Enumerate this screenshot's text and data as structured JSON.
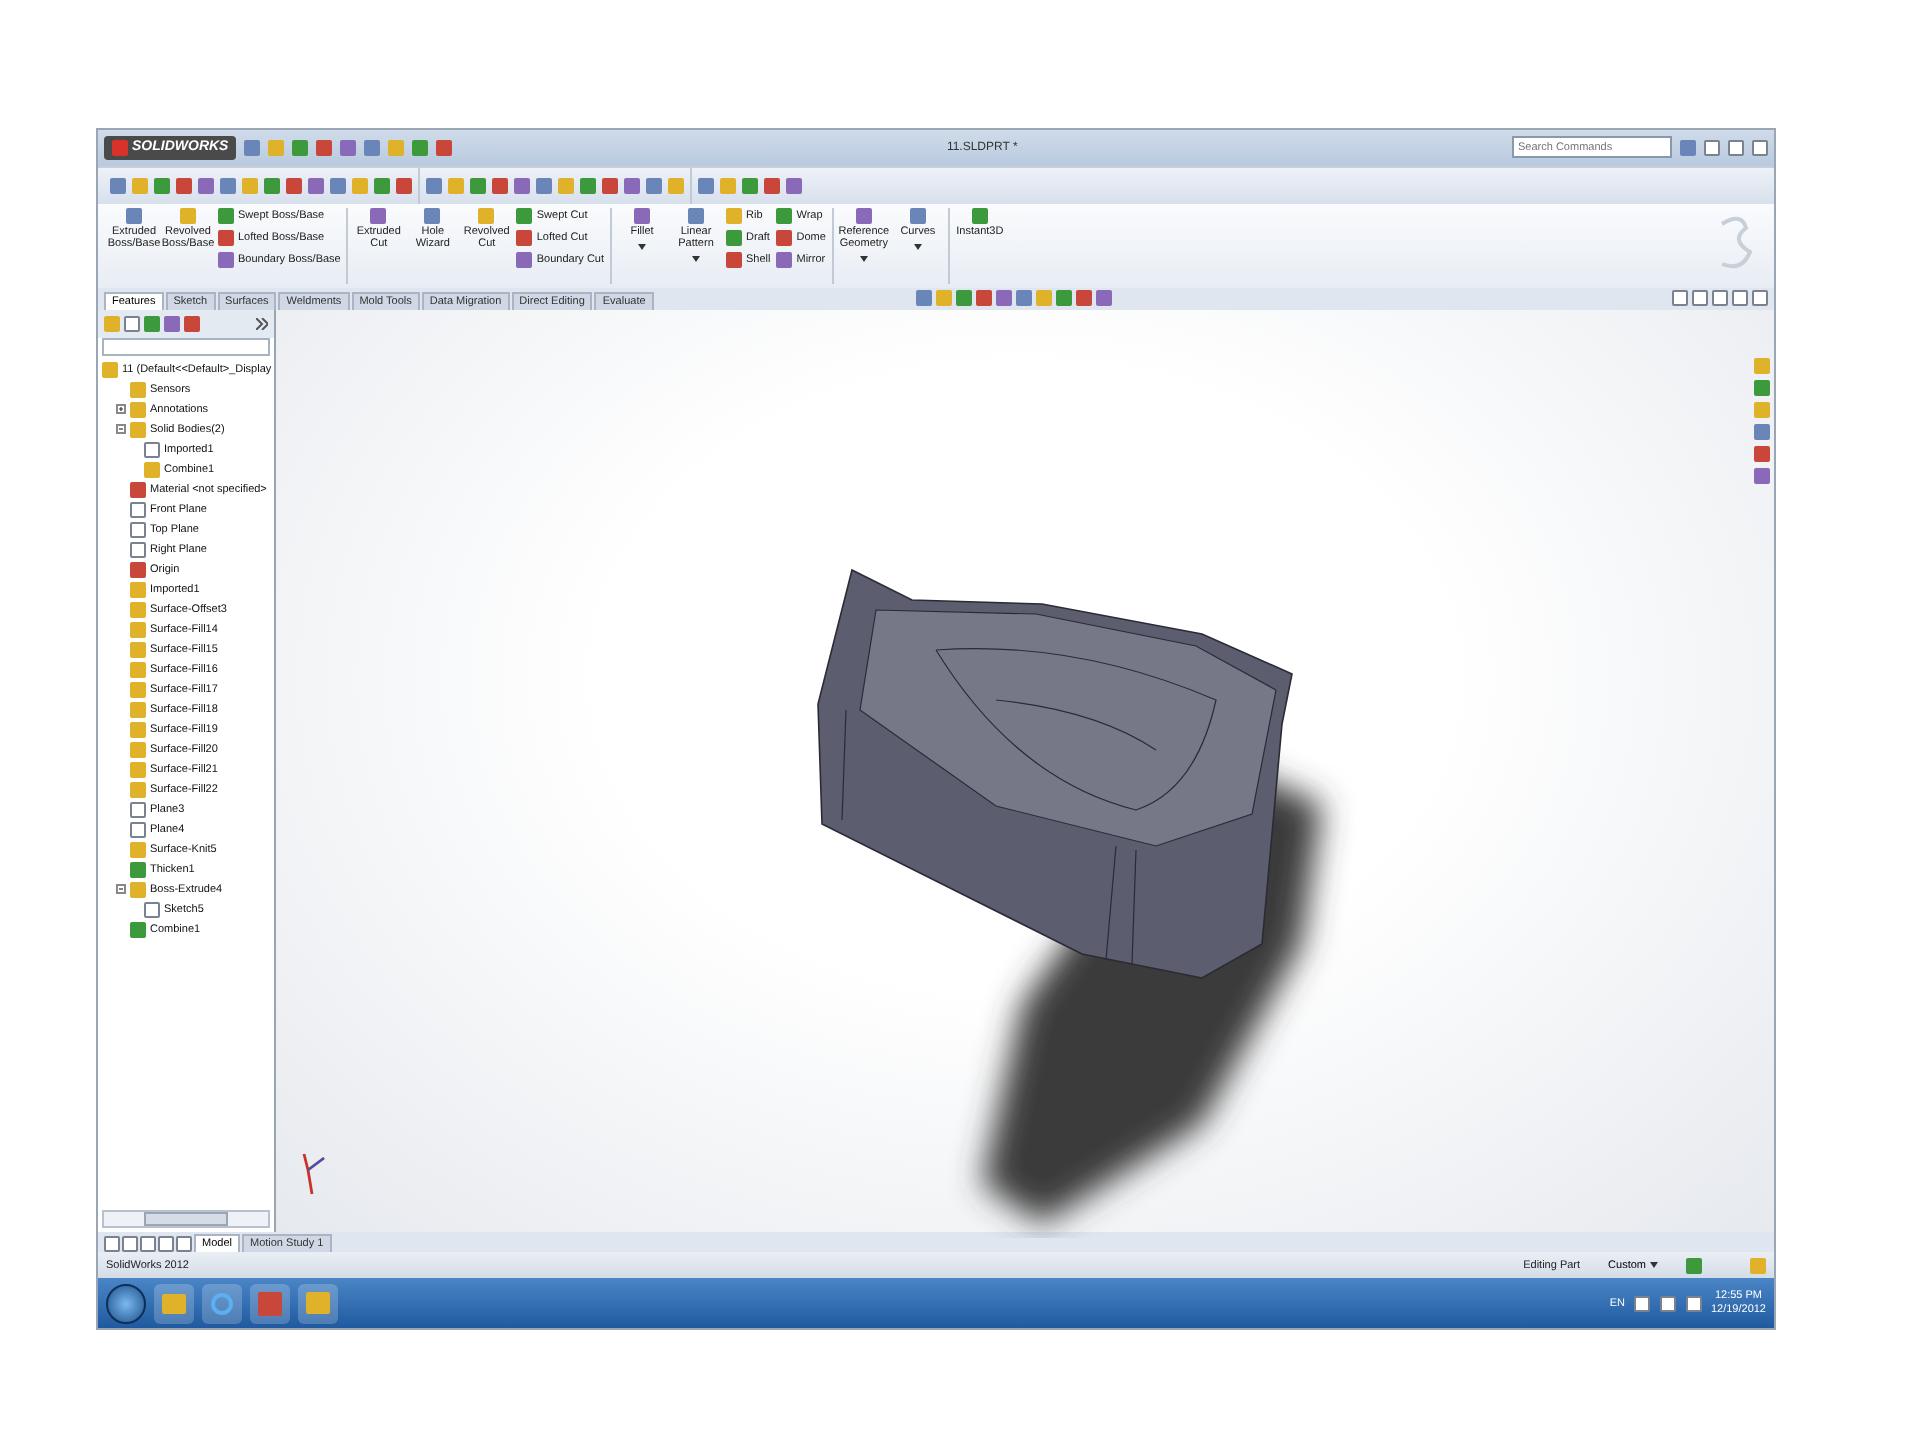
{
  "window": {
    "app": "SOLIDWORKS",
    "title": "11.SLDPRT *",
    "search": {
      "placeholder": "Search Commands"
    }
  },
  "ribbon": [
    {
      "kind": "large",
      "label": "Extruded Boss/Base",
      "dropdown": false
    },
    {
      "kind": "large",
      "label": "Revolved Boss/Base",
      "dropdown": false
    },
    {
      "kind": "stack",
      "items": [
        "Swept Boss/Base",
        "Lofted Boss/Base",
        "Boundary Boss/Base"
      ]
    },
    {
      "kind": "separator"
    },
    {
      "kind": "large",
      "label": "Extruded Cut",
      "dropdown": false
    },
    {
      "kind": "large",
      "label": "Hole Wizard",
      "dropdown": false
    },
    {
      "kind": "large",
      "label": "Revolved Cut",
      "dropdown": false
    },
    {
      "kind": "stack",
      "items": [
        "Swept Cut",
        "Lofted Cut",
        "Boundary Cut"
      ]
    },
    {
      "kind": "separator"
    },
    {
      "kind": "large",
      "label": "Fillet",
      "dropdown": true
    },
    {
      "kind": "large",
      "label": "Linear Pattern",
      "dropdown": true
    },
    {
      "kind": "stack",
      "items": [
        "Rib",
        "Draft",
        "Shell"
      ]
    },
    {
      "kind": "stack",
      "items": [
        "Wrap",
        "Dome",
        "Mirror"
      ]
    },
    {
      "kind": "separator"
    },
    {
      "kind": "large",
      "label": "Reference Geometry",
      "dropdown": true
    },
    {
      "kind": "large",
      "label": "Curves",
      "dropdown": true
    },
    {
      "kind": "separator"
    },
    {
      "kind": "large",
      "label": "Instant3D",
      "dropdown": false
    }
  ],
  "tabs": [
    {
      "label": "Features",
      "selected": true
    },
    {
      "label": "Sketch",
      "selected": false
    },
    {
      "label": "Surfaces",
      "selected": false
    },
    {
      "label": "Weldments",
      "selected": false
    },
    {
      "label": "Mold Tools",
      "selected": false
    },
    {
      "label": "Data Migration",
      "selected": false
    },
    {
      "label": "Direct Editing",
      "selected": false
    },
    {
      "label": "Evaluate",
      "selected": false
    }
  ],
  "feature_tree": {
    "root": "11  (Default<<Default>_Display",
    "items": [
      {
        "label": "Sensors"
      },
      {
        "label": "Annotations",
        "expanded": false
      },
      {
        "label": "Solid Bodies(2)",
        "expanded": true,
        "children": [
          {
            "label": "Imported1"
          },
          {
            "label": "Combine1"
          }
        ]
      },
      {
        "label": "Material <not specified>"
      },
      {
        "label": "Front Plane"
      },
      {
        "label": "Top Plane"
      },
      {
        "label": "Right Plane"
      },
      {
        "label": "Origin"
      },
      {
        "label": "Imported1"
      },
      {
        "label": "Surface-Offset3"
      },
      {
        "label": "Surface-Fill14"
      },
      {
        "label": "Surface-Fill15"
      },
      {
        "label": "Surface-Fill16"
      },
      {
        "label": "Surface-Fill17"
      },
      {
        "label": "Surface-Fill18"
      },
      {
        "label": "Surface-Fill19"
      },
      {
        "label": "Surface-Fill20"
      },
      {
        "label": "Surface-Fill21"
      },
      {
        "label": "Surface-Fill22"
      },
      {
        "label": "Plane3"
      },
      {
        "label": "Plane4"
      },
      {
        "label": "Surface-Knit5"
      },
      {
        "label": "Thicken1"
      },
      {
        "label": "Boss-Extrude4",
        "expanded": true,
        "children": [
          {
            "label": "Sketch5"
          }
        ]
      },
      {
        "label": "Combine1"
      }
    ]
  },
  "bottom_tabs": [
    {
      "label": "Model",
      "selected": true
    },
    {
      "label": "Motion Study 1",
      "selected": false
    }
  ],
  "status_bar": {
    "app": "SolidWorks 2012",
    "mode": "Editing Part",
    "units": "Custom"
  },
  "taskbar": {
    "language": "EN",
    "time": "12:55 PM",
    "date": "12/19/2012"
  }
}
